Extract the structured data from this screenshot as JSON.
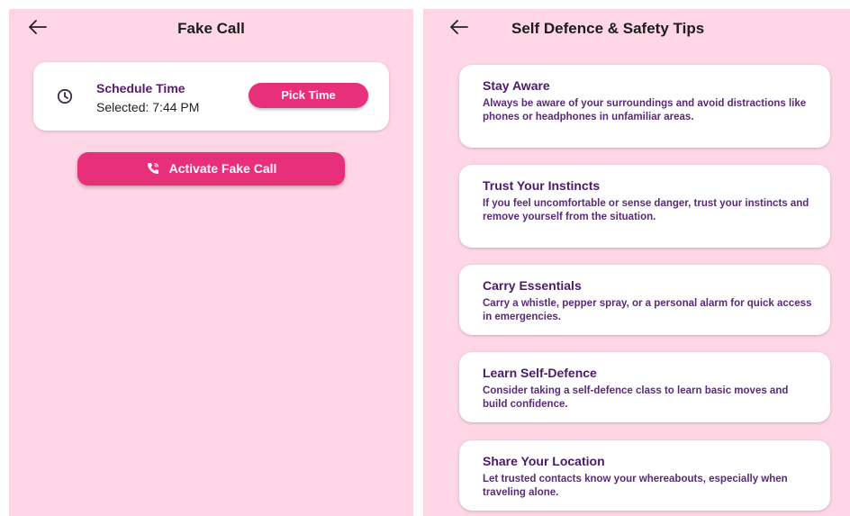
{
  "fake_call": {
    "title": "Fake Call",
    "schedule_label": "Schedule Time",
    "selected_text": "Selected: 7:44 PM",
    "pick_button": "Pick Time",
    "activate_button": "Activate Fake Call",
    "icons": {
      "back": "arrow-left-icon",
      "clock": "clock-icon",
      "phone": "phone-call-icon"
    }
  },
  "tips_screen": {
    "title": "Self Defence & Safety Tips",
    "tips": [
      {
        "title": "Stay Aware",
        "body": "Always be aware of your surroundings and avoid distractions like phones or headphones in unfamiliar areas."
      },
      {
        "title": "Trust Your Instincts",
        "body": "If you feel uncomfortable or sense danger, trust your instincts and remove yourself from the situation."
      },
      {
        "title": "Carry Essentials",
        "body": "Carry a whistle, pepper spray, or a personal alarm for quick access in emergencies."
      },
      {
        "title": "Learn Self-Defence",
        "body": "Consider taking a self-defence class to learn basic moves and build confidence."
      },
      {
        "title": "Share Your Location",
        "body": "Let trusted contacts know your whereabouts, especially when traveling alone."
      }
    ]
  },
  "colors": {
    "background": "#ffd6e6",
    "accent": "#e8307a",
    "card": "#ffffff",
    "heading_purple": "#4a1a6b"
  }
}
